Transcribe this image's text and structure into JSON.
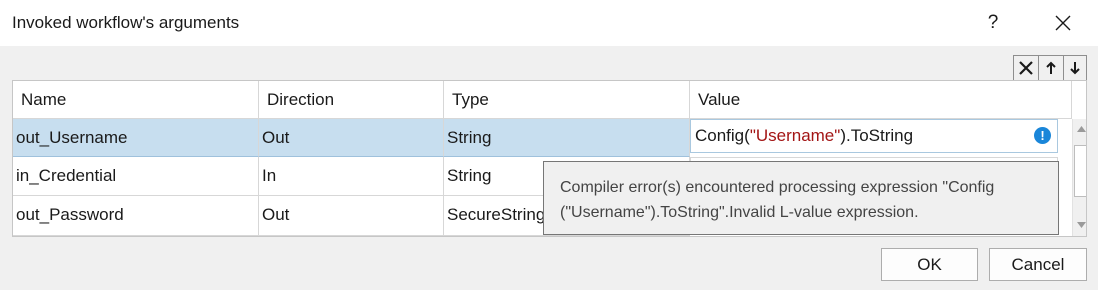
{
  "window": {
    "title": "Invoked workflow's arguments",
    "help_label": "?"
  },
  "toolbar": {
    "icons": [
      "delete-icon",
      "arrow-up-icon",
      "arrow-down-icon"
    ]
  },
  "grid": {
    "columns": [
      "Name",
      "Direction",
      "Type",
      "Value"
    ],
    "rows": [
      {
        "name": "out_Username",
        "direction": "Out",
        "type": "String",
        "value_prefix": "Config(",
        "value_string": "\"Username\"",
        "value_suffix": ").ToString",
        "selected": true
      },
      {
        "name": "in_Credential",
        "direction": "In",
        "type": "String",
        "value": ""
      },
      {
        "name": "out_Password",
        "direction": "Out",
        "type": "SecureString",
        "value": ""
      }
    ]
  },
  "tooltip": {
    "line1": "Compiler error(s) encountered processing expression \"Config",
    "line2": "(\"Username\").ToString\".Invalid L-value expression."
  },
  "buttons": {
    "ok": "OK",
    "cancel": "Cancel"
  },
  "colors": {
    "selection": "#c7deef",
    "string_literal": "#a31515",
    "error_icon": "#1a86d9"
  }
}
